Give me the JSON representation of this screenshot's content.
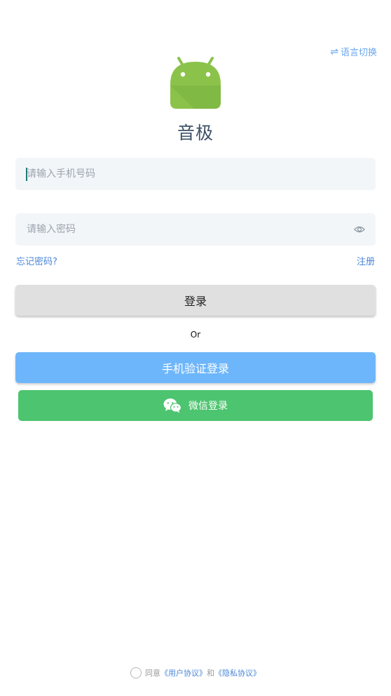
{
  "header": {
    "lang_switch_icon": "⇌",
    "lang_switch_label": "语言切换"
  },
  "app": {
    "logo_icon": "android-icon",
    "name": "音极"
  },
  "form": {
    "phone_placeholder": "请输入手机号码",
    "password_placeholder": "请输入密码",
    "forgot_password": "忘记密码?",
    "register": "注册",
    "login_button": "登录",
    "or_text": "Or",
    "phone_login_button": "手机验证登录",
    "wechat_login_button": "微信登录"
  },
  "agreement": {
    "agree_text": "同意",
    "user_agreement": "《用户协议》",
    "and_text": "和",
    "privacy_agreement": "《隐私协议》",
    "checked": false
  },
  "colors": {
    "accent": "#6aa8ee",
    "phone_login": "#6eb6fb",
    "wechat": "#4dc46f",
    "login_button": "#e0e0e0",
    "logo_green": "#8bc34a"
  }
}
